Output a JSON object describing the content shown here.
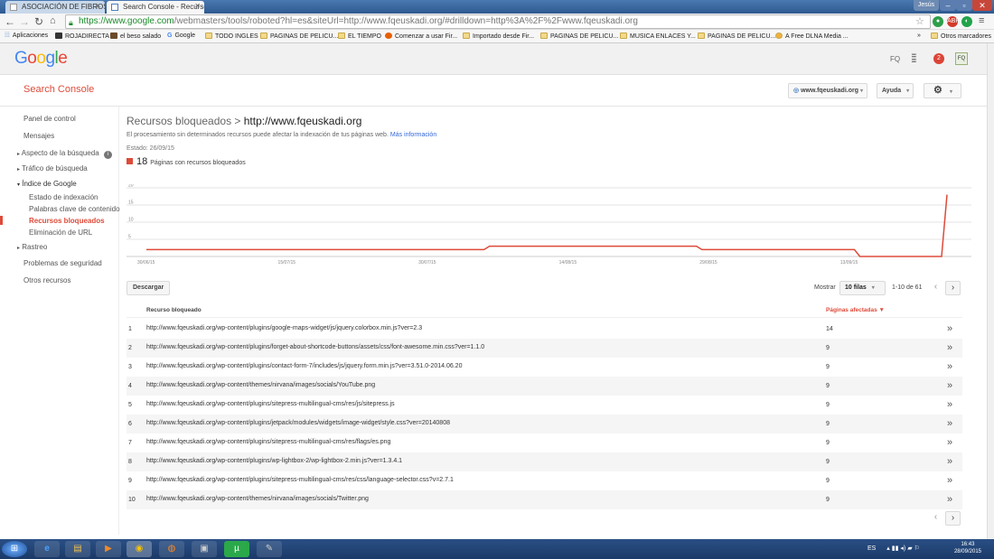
{
  "browser": {
    "tabs": [
      {
        "label": "ASOCIACIÓN DE FIBROSI",
        "active": false
      },
      {
        "label": "Search Console - Recursos",
        "active": true
      }
    ],
    "user_badge": "Jesús",
    "url_secure": "https://www.google.com",
    "url_rest": "/webmasters/tools/roboted?hl=es&siteUrl=http://www.fqeuskadi.org/#drilldown=http%3A%2F%2Fwww.fqeuskadi.org",
    "bookmarks": [
      "Aplicaciones",
      "ROJADIRECTA",
      "el beso salado",
      "Google",
      "TODO INGLES",
      "PAGINAS DE PELICU...",
      "EL TIEMPO",
      "Comenzar a usar Fir...",
      "Importado desde Fir...",
      "PAGINAS DE PELICU...",
      "MUSICA ENLACES Y...",
      "PAGINAS DE PELICU...",
      "A Free DLNA Media ..."
    ],
    "bookmarks_more": "»",
    "other_bookmarks": "Otros marcadores"
  },
  "google_header": {
    "logo": "Google",
    "user_initials": "FQ",
    "notifications": "2",
    "avatar": "FQ"
  },
  "sc_header": {
    "title": "Search Console",
    "site_selector": "www.fqeuskadi.org",
    "help": "Ayuda"
  },
  "sidebar": {
    "items": [
      {
        "label": "Panel de control"
      },
      {
        "label": "Mensajes"
      },
      {
        "label": "Aspecto de la búsqueda"
      },
      {
        "label": "Tráfico de búsqueda"
      },
      {
        "label": "Índice de Google"
      },
      {
        "label": "Estado de indexación"
      },
      {
        "label": "Palabras clave de contenido"
      },
      {
        "label": "Recursos bloqueados"
      },
      {
        "label": "Eliminación de URL"
      },
      {
        "label": "Rastreo"
      },
      {
        "label": "Problemas de seguridad"
      },
      {
        "label": "Otros recursos"
      }
    ]
  },
  "main": {
    "title_prefix": "Recursos bloqueados > ",
    "title_site": "http://www.fqeuskadi.org",
    "description": "El procesamiento sin determinados recursos puede afectar la indexación de tus páginas web.",
    "more_info": "Más información",
    "status": "Estado: 26/09/15",
    "legend_count": "18",
    "legend_label": "Páginas con recursos bloqueados",
    "download_button": "Descargar",
    "show_label": "Mostrar",
    "rows_select": "10 filas",
    "range": "1-10 de 61",
    "col_resource": "Recurso bloqueado",
    "col_pages": "Páginas afectadas ▼",
    "rows": [
      {
        "idx": "1",
        "url": "http://www.fqeuskadi.org/wp-content/plugins/google-maps-widget/js/jquery.colorbox.min.js?ver=2.3",
        "count": "14"
      },
      {
        "idx": "2",
        "url": "http://www.fqeuskadi.org/wp-content/plugins/forget-about-shortcode-buttons/assets/css/font-awesome.min.css?ver=1.1.0",
        "count": "9"
      },
      {
        "idx": "3",
        "url": "http://www.fqeuskadi.org/wp-content/plugins/contact-form-7/includes/js/jquery.form.min.js?ver=3.51.0-2014.06.20",
        "count": "9"
      },
      {
        "idx": "4",
        "url": "http://www.fqeuskadi.org/wp-content/themes/nirvana/images/socials/YouTube.png",
        "count": "9"
      },
      {
        "idx": "5",
        "url": "http://www.fqeuskadi.org/wp-content/plugins/sitepress-multilingual-cms/res/js/sitepress.js",
        "count": "9"
      },
      {
        "idx": "6",
        "url": "http://www.fqeuskadi.org/wp-content/plugins/jetpack/modules/widgets/image-widget/style.css?ver=20140808",
        "count": "9"
      },
      {
        "idx": "7",
        "url": "http://www.fqeuskadi.org/wp-content/plugins/sitepress-multilingual-cms/res/flags/es.png",
        "count": "9"
      },
      {
        "idx": "8",
        "url": "http://www.fqeuskadi.org/wp-content/plugins/wp-lightbox-2/wp-lightbox-2.min.js?ver=1.3.4.1",
        "count": "9"
      },
      {
        "idx": "9",
        "url": "http://www.fqeuskadi.org/wp-content/plugins/sitepress-multilingual-cms/res/css/language-selector.css?v=2.7.1",
        "count": "9"
      },
      {
        "idx": "10",
        "url": "http://www.fqeuskadi.org/wp-content/themes/nirvana/images/socials/Twitter.png",
        "count": "9"
      }
    ]
  },
  "chart_data": {
    "type": "line",
    "y_ticks": [
      "20",
      "15",
      "10",
      "5"
    ],
    "ylim": [
      0,
      20
    ],
    "x_ticks": [
      "30/06/15",
      "15/07/15",
      "30/07/15",
      "14/08/15",
      "29/08/15",
      "13/09/15"
    ],
    "series": [
      {
        "color": "#dd4b39",
        "values": [
          2,
          2,
          2,
          2,
          2,
          2,
          2,
          2,
          2,
          2,
          2,
          2,
          2,
          2,
          2,
          2,
          2,
          2,
          2,
          2,
          2,
          2,
          2,
          2,
          2,
          2,
          2,
          2,
          2,
          2,
          2,
          2,
          2,
          2,
          2,
          2,
          2,
          2,
          2,
          2,
          2,
          2,
          2,
          2,
          2,
          2,
          2,
          2,
          2,
          2,
          2,
          2,
          2,
          2,
          2,
          2,
          2,
          2,
          2,
          2,
          2,
          2,
          2,
          3,
          3,
          3,
          3,
          3,
          3,
          3,
          3,
          3,
          3,
          3,
          3,
          3,
          3,
          3,
          3,
          3,
          3,
          3,
          3,
          3,
          3,
          3,
          3,
          3,
          3,
          3,
          3,
          3,
          3,
          3,
          3,
          3,
          3,
          3,
          3,
          3,
          3,
          3,
          2,
          2,
          2,
          2,
          2,
          2,
          2,
          2,
          2,
          2,
          2,
          2,
          2,
          2,
          2,
          2,
          2,
          2,
          2,
          2,
          2,
          2,
          2,
          2,
          2,
          2,
          2,
          2,
          2,
          0,
          0,
          0,
          0,
          0,
          0,
          0,
          0,
          0,
          0,
          0,
          0,
          0,
          0,
          0,
          0,
          18
        ]
      }
    ]
  },
  "taskbar": {
    "lang": "ES",
    "time": "16:43",
    "date": "28/09/2015"
  }
}
